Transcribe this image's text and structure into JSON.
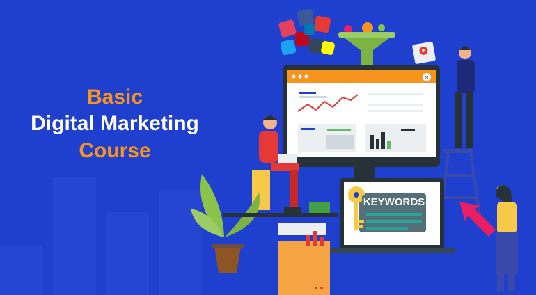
{
  "headline": {
    "line1": "Basic",
    "line2": "Digital Marketing",
    "line3": "Course"
  },
  "illustration": {
    "laptop_label": "KEYWORDS"
  },
  "colors": {
    "background": "#1f3fcf",
    "accent": "#f7941d",
    "text_primary": "#ffffff"
  }
}
